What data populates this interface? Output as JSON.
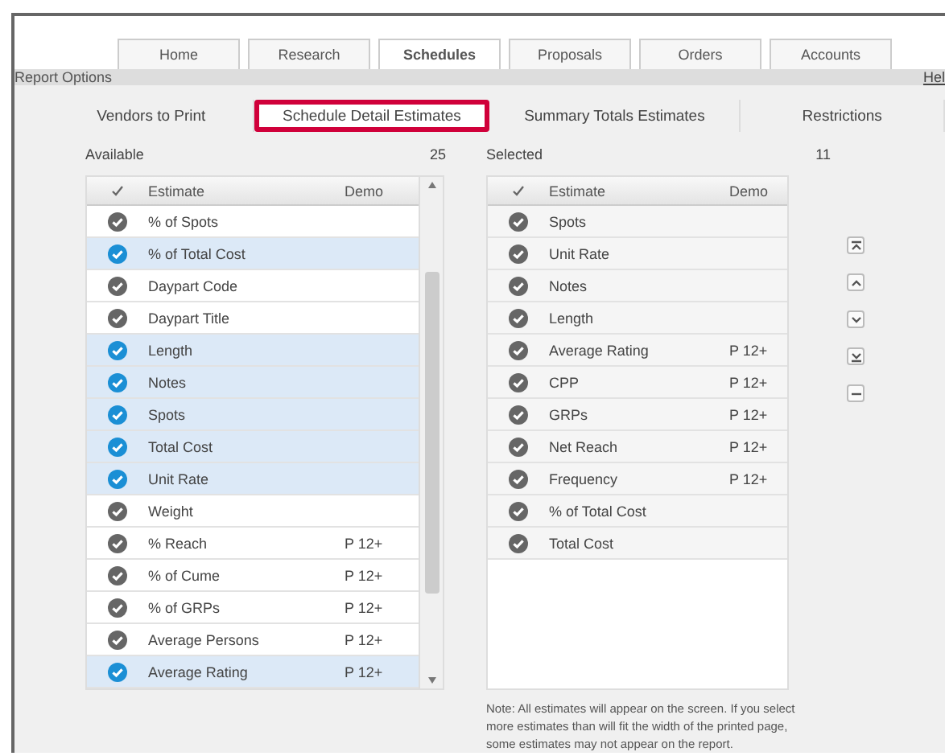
{
  "tabs": [
    {
      "label": "Home",
      "selected": false
    },
    {
      "label": "Research",
      "selected": false
    },
    {
      "label": "Schedules",
      "selected": true
    },
    {
      "label": "Proposals",
      "selected": false
    },
    {
      "label": "Orders",
      "selected": false
    },
    {
      "label": "Accounts",
      "selected": false
    }
  ],
  "report_options": {
    "title": "Report Options",
    "help": "Hel"
  },
  "sub_tabs": [
    {
      "label": "Vendors to Print",
      "selected": false
    },
    {
      "label": "Schedule Detail Estimates",
      "selected": true
    },
    {
      "label": "Summary Totals Estimates",
      "selected": false
    },
    {
      "label": "Restrictions",
      "selected": false
    }
  ],
  "available": {
    "label": "Available",
    "count": "25",
    "columns": [
      "Estimate",
      "Demo"
    ],
    "rows": [
      {
        "estimate": "% of Spots",
        "selected": false
      },
      {
        "estimate": "% of Total Cost",
        "selected": true
      },
      {
        "estimate": "Daypart Code",
        "selected": false
      },
      {
        "estimate": "Daypart Title",
        "selected": false
      },
      {
        "estimate": "Length",
        "selected": true
      },
      {
        "estimate": "Notes",
        "selected": true
      },
      {
        "estimate": "Spots",
        "selected": true
      },
      {
        "estimate": "Total Cost",
        "selected": true
      },
      {
        "estimate": "Unit Rate",
        "selected": true
      },
      {
        "estimate": "Weight",
        "selected": false
      },
      {
        "estimate": "% Reach",
        "demo": "P 12+",
        "selected": false
      },
      {
        "estimate": "% of Cume",
        "demo": "P 12+",
        "selected": false
      },
      {
        "estimate": "% of GRPs",
        "demo": "P 12+",
        "selected": false
      },
      {
        "estimate": "Average Persons",
        "demo": "P 12+",
        "selected": false
      },
      {
        "estimate": "Average Rating",
        "demo": "P 12+",
        "selected": true
      }
    ]
  },
  "selected": {
    "label": "Selected",
    "count": "11",
    "columns": [
      "Estimate",
      "Demo"
    ],
    "rows": [
      {
        "estimate": "Spots",
        "selected": false
      },
      {
        "estimate": "Unit Rate",
        "selected": false
      },
      {
        "estimate": "Notes",
        "selected": false
      },
      {
        "estimate": "Length",
        "selected": false
      },
      {
        "estimate": "Average Rating",
        "demo": "P 12+",
        "selected": false
      },
      {
        "estimate": "CPP",
        "demo": "P 12+",
        "selected": false
      },
      {
        "estimate": "GRPs",
        "demo": "P 12+",
        "selected": false
      },
      {
        "estimate": "Net Reach",
        "demo": "P 12+",
        "selected": false
      },
      {
        "estimate": "Frequency",
        "demo": "P 12+",
        "selected": false
      },
      {
        "estimate": "% of Total Cost",
        "selected": false
      },
      {
        "estimate": "Total Cost",
        "selected": false
      }
    ]
  },
  "order_buttons": [
    {
      "kind": "top"
    },
    {
      "kind": "up"
    },
    {
      "kind": "down"
    },
    {
      "kind": "bottom"
    },
    {
      "kind": "remove"
    }
  ],
  "note": "Note: All estimates will appear on the screen. If you select more estimates than will fit the width of the printed page, some estimates may not appear on the report."
}
